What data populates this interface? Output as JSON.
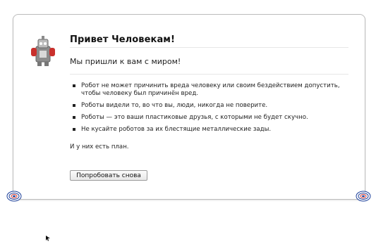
{
  "card": {
    "title": "Привет Человекам!",
    "subtitle": "Мы пришли к вам с миром!",
    "bullets": [
      "Робот не может причинить вреда человеку или своим бездействием допустить, чтобы человеку был причинён вред.",
      "Роботы видели то, во что вы, люди, никогда не поверите.",
      "Роботы — это ваши пластиковые друзья, с которыми не будет скучно.",
      "Не кусайте роботов за их блестящие металлические зады."
    ],
    "plan_text": "И у них есть план.",
    "retry_button_label": "Попробовать снова"
  },
  "icons": {
    "robot": "robot-icon",
    "bolt_left": "bolt-icon",
    "bolt_right": "bolt-icon",
    "cursor": "cursor-icon"
  },
  "colors": {
    "border": "#bdbdbd",
    "robot_red": "#c9302c",
    "bolt_blue": "#1b3f9a",
    "bolt_red": "#d33b35"
  }
}
